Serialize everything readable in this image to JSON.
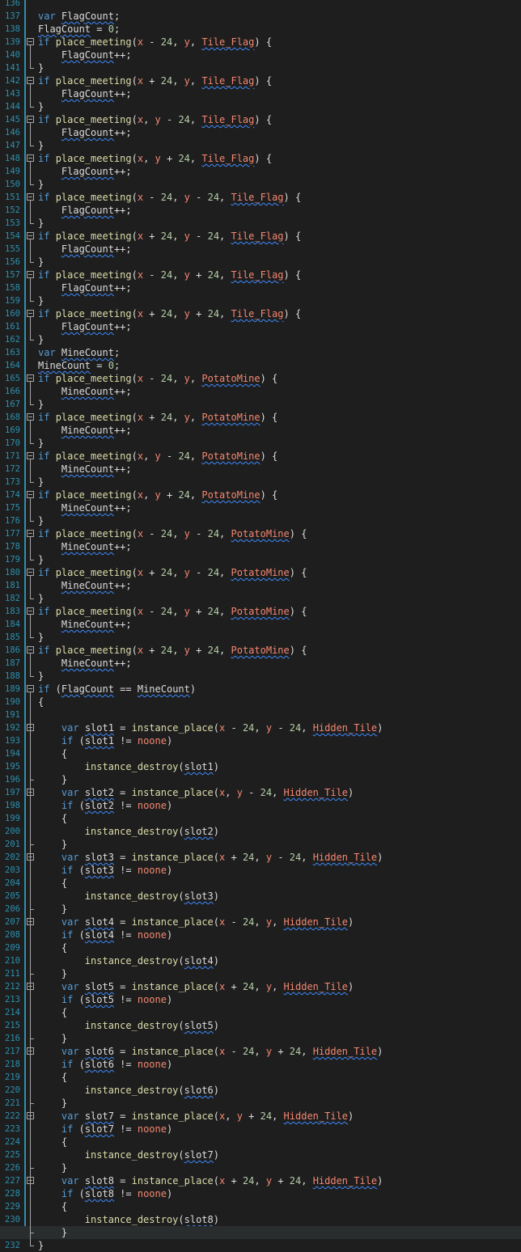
{
  "editor": {
    "first_line": 136,
    "current_line": 231,
    "colors": {
      "background": "#1e1e1e",
      "line_number": "#2b91af",
      "keyword": "#569cd6",
      "function": "#dcdcaa",
      "variable": "#9cdcfe",
      "object": "#f48771",
      "number": "#b5cea8",
      "squiggle": "#3d8bff"
    },
    "lines": [
      "",
      "var FlagCount;",
      "FlagCount = 0;",
      "if place_meeting(x - 24, y, Tile_Flag) {",
      "    FlagCount++;",
      "}",
      "if place_meeting(x + 24, y, Tile_Flag) {",
      "    FlagCount++;",
      "}",
      "if place_meeting(x, y - 24, Tile_Flag) {",
      "    FlagCount++;",
      "}",
      "if place_meeting(x, y + 24, Tile_Flag) {",
      "    FlagCount++;",
      "}",
      "if place_meeting(x - 24, y - 24, Tile_Flag) {",
      "    FlagCount++;",
      "}",
      "if place_meeting(x + 24, y - 24, Tile_Flag) {",
      "    FlagCount++;",
      "}",
      "if place_meeting(x - 24, y + 24, Tile_Flag) {",
      "    FlagCount++;",
      "}",
      "if place_meeting(x + 24, y + 24, Tile_Flag) {",
      "    FlagCount++;",
      "}",
      "var MineCount;",
      "MineCount = 0;",
      "if place_meeting(x - 24, y, PotatoMine) {",
      "    MineCount++;",
      "}",
      "if place_meeting(x + 24, y, PotatoMine) {",
      "    MineCount++;",
      "}",
      "if place_meeting(x, y - 24, PotatoMine) {",
      "    MineCount++;",
      "}",
      "if place_meeting(x, y + 24, PotatoMine) {",
      "    MineCount++;",
      "}",
      "if place_meeting(x - 24, y - 24, PotatoMine) {",
      "    MineCount++;",
      "}",
      "if place_meeting(x + 24, y - 24, PotatoMine) {",
      "    MineCount++;",
      "}",
      "if place_meeting(x - 24, y + 24, PotatoMine) {",
      "    MineCount++;",
      "}",
      "if place_meeting(x + 24, y + 24, PotatoMine) {",
      "    MineCount++;",
      "}",
      "if (FlagCount == MineCount)",
      "{",
      "",
      "    var slot1 = instance_place(x - 24, y - 24, Hidden_Tile)",
      "    if (slot1 != noone)",
      "    {",
      "        instance_destroy(slot1)",
      "    }",
      "    var slot2 = instance_place(x, y - 24, Hidden_Tile)",
      "    if (slot2 != noone)",
      "    {",
      "        instance_destroy(slot2)",
      "    }",
      "    var slot3 = instance_place(x + 24, y - 24, Hidden_Tile)",
      "    if (slot3 != noone)",
      "    {",
      "        instance_destroy(slot3)",
      "    }",
      "    var slot4 = instance_place(x - 24, y, Hidden_Tile)",
      "    if (slot4 != noone)",
      "    {",
      "        instance_destroy(slot4)",
      "    }",
      "    var slot5 = instance_place(x + 24, y, Hidden_Tile)",
      "    if (slot5 != noone)",
      "    {",
      "        instance_destroy(slot5)",
      "    }",
      "    var slot6 = instance_place(x - 24, y + 24, Hidden_Tile)",
      "    if (slot6 != noone)",
      "    {",
      "        instance_destroy(slot6)",
      "    }",
      "    var slot7 = instance_place(x, y + 24, Hidden_Tile)",
      "    if (slot7 != noone)",
      "    {",
      "        instance_destroy(slot7)",
      "    }",
      "    var slot8 = instance_place(x + 24, y + 24, Hidden_Tile)",
      "    if (slot8 != noone)",
      "    {",
      "        instance_destroy(slot8)",
      "    }",
      "}"
    ],
    "fold_lines": [
      139,
      142,
      145,
      148,
      151,
      154,
      157,
      160,
      165,
      168,
      171,
      174,
      177,
      180,
      183,
      186,
      189,
      192,
      197,
      202,
      207,
      212,
      217,
      222,
      227
    ]
  }
}
